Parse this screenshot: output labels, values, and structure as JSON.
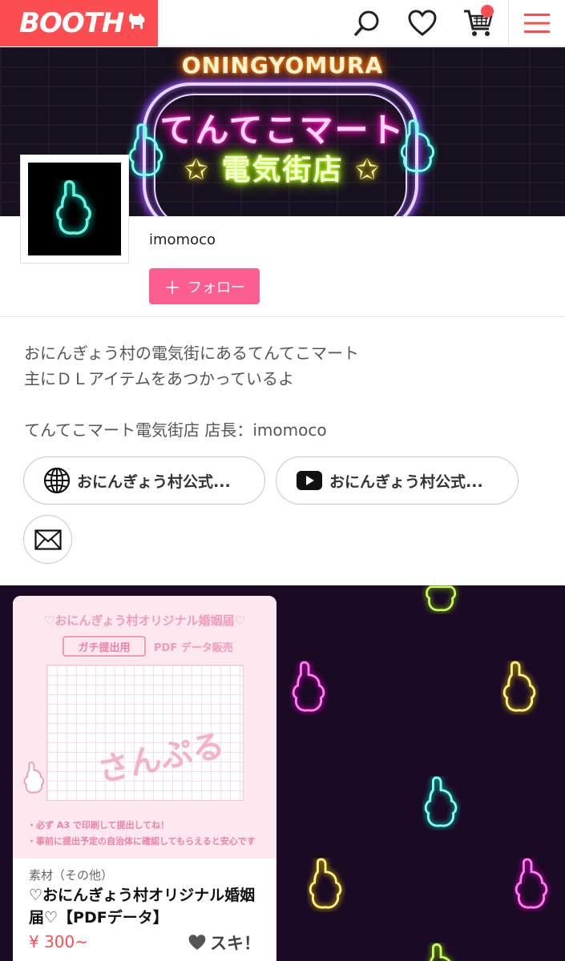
{
  "header": {
    "logo": "BOOTH",
    "icons": [
      "search-icon",
      "heart-icon",
      "cart-icon",
      "menu-icon"
    ]
  },
  "banner": {
    "top_text": "ONINGYOMURA",
    "main_text": "てんてこマート",
    "sub_text": "電気街店",
    "star": "✩"
  },
  "shop": {
    "name": "imomoco",
    "follow_label": "フォロー",
    "follow_plus": "＋"
  },
  "description": {
    "line1": "おにんぎょう村の電気街にあるてんてこマート",
    "line2": "主にＤＬアイテムをあつかっているよ",
    "line3": "てんてこマート電気街店 店長：imomoco"
  },
  "links": [
    {
      "label": "おにんぎょう村公式...",
      "icon": "globe-icon"
    },
    {
      "label": "おにんぎょう村公式...",
      "icon": "youtube-icon"
    }
  ],
  "product": {
    "image": {
      "title": "♡おにんぎょう村オリジナル婚姻届♡",
      "tag1": "ガチ提出用",
      "tag2": "PDF データ販売",
      "stamp": "さんぷる",
      "note1": "・必ず A3 で印刷して提出してね！",
      "note2": "・事前に提出予定の自治体に確認してもらえると安心です"
    },
    "category": "素材（その他）",
    "title": "♡おにんぎょう村オリジナル婚姻届♡【PDFデータ】",
    "price": "¥ 300~",
    "like_label": "スキ！"
  },
  "colors": {
    "brand": "#fc4d50",
    "follow": "#fc5f8f",
    "price": "#fc4d50"
  }
}
